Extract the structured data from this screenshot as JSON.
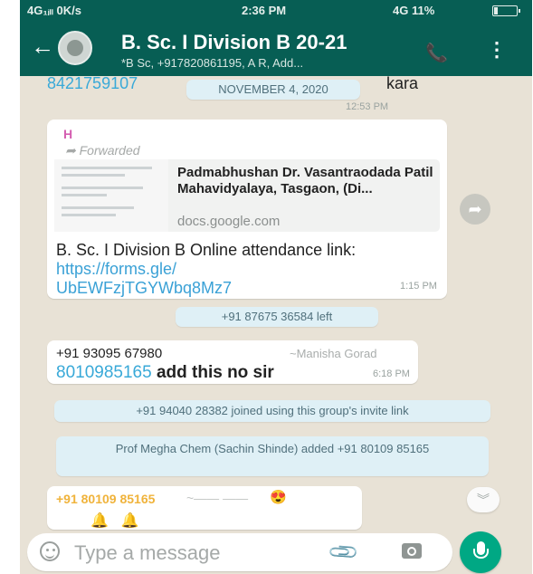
{
  "status_bar": {
    "left": "4G₁ᵢₗₗ 0K/s",
    "time": "2:36 PM",
    "right": "4G 11%"
  },
  "header": {
    "title": "B. Sc. I Division B 20-21",
    "subtitle": "*B Sc, +917820861195, A R, Add..."
  },
  "chat": {
    "top_number": "8421759107",
    "date_chip": "NOVEMBER 4, 2020",
    "top_fragment": "kara",
    "top_time": "12:53 PM",
    "msg1": {
      "sender": "H",
      "forwarded": "Forwarded",
      "preview_title": "Padmabhushan Dr. Vasantraodada Patil Mahavidyalaya, Tasgaon, (Di...",
      "preview_domain": "docs.google.com",
      "body_text": "B. Sc. I Division B Online attendance link: ",
      "link_part1": "https://forms.gle/",
      "link_part2": "UbEWFzjTGYWbq8Mz7",
      "time": "1:15 PM"
    },
    "sys_left": "+91 87675 36584 left",
    "msg2": {
      "sender": "+91 93095 67980",
      "sender_name": "~Manisha Gorad",
      "number": "8010985165",
      "text": " add this no sir",
      "time": "6:18 PM"
    },
    "sys_joined": "+91 94040 28382 joined using this group's invite link",
    "sys_added": "Prof Megha Chem (Sachin Shinde) added +91 80109 85165",
    "msg3": {
      "sender": "+91 80109 85165",
      "name_dash": "~—— ——",
      "emoji": "😍",
      "bells": "🔔🔔"
    }
  },
  "composer": {
    "placeholder": "Type a message"
  },
  "colors": {
    "header": "#075e54",
    "link": "#39a9d8",
    "mic": "#00a884",
    "wallpaper": "#e8e2d6"
  }
}
